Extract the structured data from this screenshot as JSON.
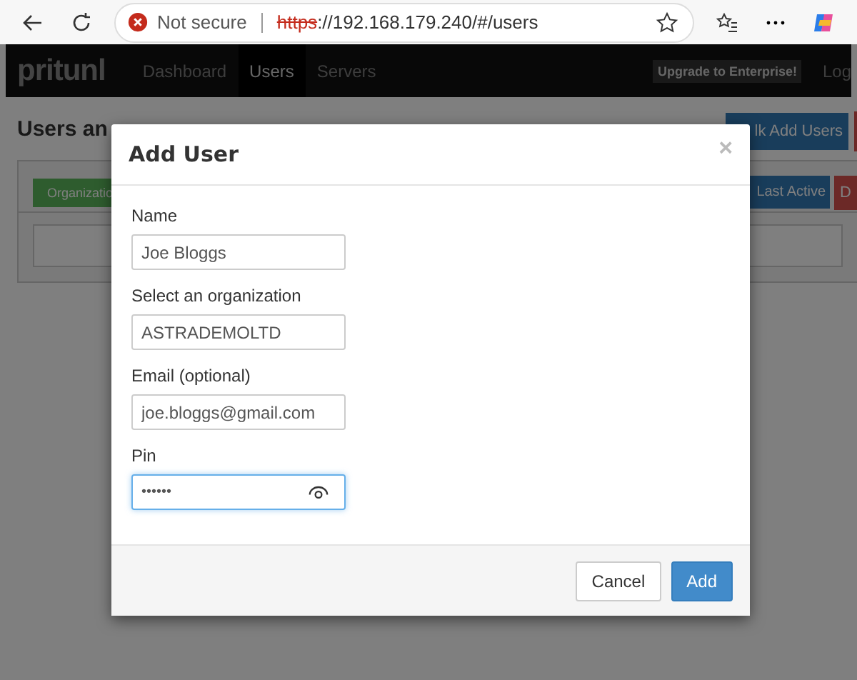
{
  "browser": {
    "security_label": "Not secure",
    "url_scheme": "https",
    "url_rest": "://192.168.179.240/#/users"
  },
  "navbar": {
    "brand": "pritunl",
    "items": [
      {
        "label": "Dashboard",
        "selected": false
      },
      {
        "label": "Users",
        "selected": true
      },
      {
        "label": "Servers",
        "selected": false
      }
    ],
    "upgrade_button": "Upgrade to Enterprise!",
    "trailing_link": "Log"
  },
  "page": {
    "title": "Users an",
    "header_button": "lk Add Users",
    "org_button": "Organizatio",
    "sort_button": "Last Active",
    "delete_button": "D"
  },
  "modal": {
    "title": "Add User",
    "close": "×",
    "fields": [
      {
        "label": "Name",
        "value": "Joe Bloggs",
        "kind": "text",
        "focused": false
      },
      {
        "label": "Select an organization",
        "value": "ASTRADEMOLTD",
        "kind": "text",
        "focused": false
      },
      {
        "label": "Email (optional)",
        "value": "joe.bloggs@gmail.com",
        "kind": "text",
        "focused": false
      },
      {
        "label": "Pin",
        "value": "••••••",
        "kind": "password",
        "focused": true
      }
    ],
    "buttons": [
      {
        "label": "Cancel",
        "kind": "default"
      },
      {
        "label": "Add",
        "kind": "primary"
      }
    ]
  }
}
